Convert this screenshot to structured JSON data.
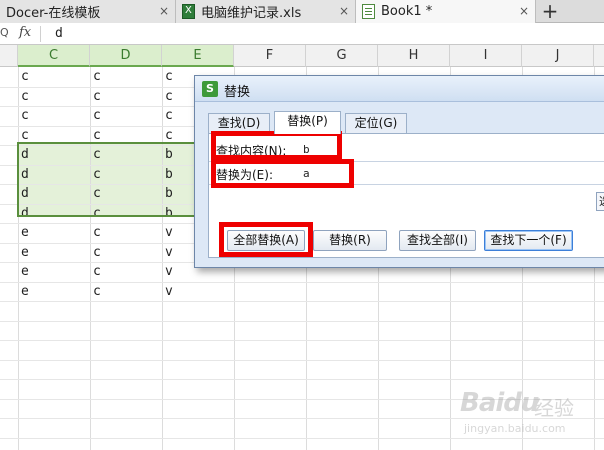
{
  "tabs": [
    {
      "label": "Docer-在线模板",
      "close": "×"
    },
    {
      "label": "电脑维护记录.xls",
      "close": "×"
    },
    {
      "label": "Book1 *",
      "close": "×"
    }
  ],
  "new_tab": "+",
  "formula_bar": {
    "zoom": "Q",
    "fx": "fx",
    "value": "d"
  },
  "columns": [
    "C",
    "D",
    "E",
    "F",
    "G",
    "H",
    "I",
    "J"
  ],
  "rows": [
    [
      "c",
      "c",
      "c"
    ],
    [
      "c",
      "c",
      "c"
    ],
    [
      "c",
      "c",
      "c"
    ],
    [
      "c",
      "c",
      "c"
    ],
    [
      "d",
      "c",
      "b"
    ],
    [
      "d",
      "c",
      "b"
    ],
    [
      "d",
      "c",
      "b"
    ],
    [
      "d",
      "c",
      "b"
    ],
    [
      "e",
      "c",
      "v"
    ],
    [
      "e",
      "c",
      "v"
    ],
    [
      "e",
      "c",
      "v"
    ],
    [
      "e",
      "c",
      "v"
    ]
  ],
  "dialog": {
    "logo": "S",
    "title": "替换",
    "tabs": [
      "查找(D)",
      "替换(P)",
      "定位(G)"
    ],
    "find_label": "查找内容(N):",
    "find_value": "b",
    "replace_label": "替换为(E):",
    "replace_value": "a",
    "side_button": "选",
    "buttons": [
      "全部替换(A)",
      "替换(R)",
      "查找全部(I)",
      "查找下一个(F)"
    ]
  },
  "watermark": {
    "brand": "Baidu",
    "cn": "经验",
    "url": "jingyan.baidu.com"
  }
}
